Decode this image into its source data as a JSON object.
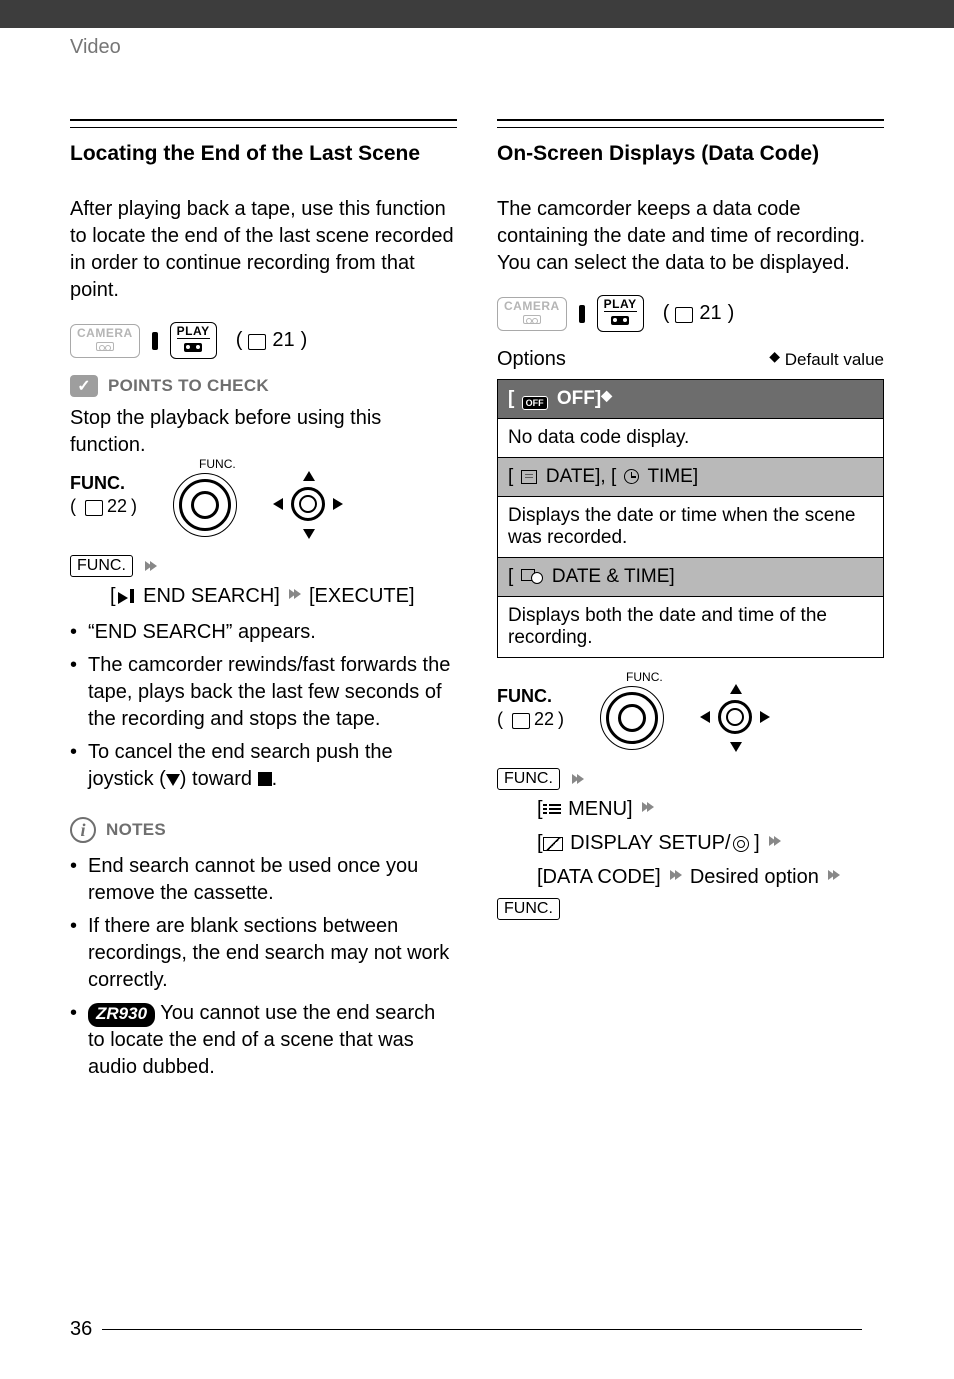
{
  "header": {
    "section": "Video"
  },
  "pageNumber": "36",
  "modeRef": "21",
  "left": {
    "title": "Locating the End of the Last Scene",
    "intro": "After playing back a tape, use this function to locate the end of the last scene recorded in order to continue recording from that point.",
    "modes": {
      "camera": "CAMERA",
      "play": "PLAY"
    },
    "pointsHeading": "POINTS TO CHECK",
    "pointsBody": "Stop the playback before using this function.",
    "func": {
      "label": "FUNC.",
      "ref": "22",
      "dialLabel": "FUNC."
    },
    "step": {
      "funcBox": "FUNC.",
      "endSearch": "END SEARCH]",
      "execute": "[EXECUTE]"
    },
    "bullets": [
      "“END SEARCH” appears.",
      "The camcorder rewinds/fast forwards the tape, plays back the last few seconds of the recording and stops the tape.",
      "To cancel the end search push the joystick (   ) toward    ."
    ],
    "bullet3_pre": "To cancel the end search push the joystick (",
    "bullet3_mid": ") toward ",
    "bullet3_post": ".",
    "notesHeading": "NOTES",
    "notes": {
      "n1": "End search cannot be used once you remove the cassette.",
      "n2": "If there are blank sections between recordings, the end search may not work correctly.",
      "n3_model": "ZR930",
      "n3_text": " You cannot use the end search to locate the end of a scene that was audio dubbed."
    }
  },
  "right": {
    "title": "On-Screen Displays (Data Code)",
    "intro": "The camcorder keeps a data code containing the date and time of recording. You can select the data to be displayed.",
    "modes": {
      "camera": "CAMERA",
      "play": "PLAY"
    },
    "optionsLabel": "Options",
    "defaultLabel": "Default value",
    "table": {
      "offHead": "OFF]",
      "offDesc": "No data code display.",
      "dateTimeHead": {
        "date": "DATE], [",
        "time": "TIME]"
      },
      "dateTimeDesc": "Displays the date or time when the scene was recorded.",
      "bothHead": "DATE & TIME]",
      "bothDesc": "Displays both the date and time of the recording."
    },
    "func": {
      "label": "FUNC.",
      "ref": "22",
      "dialLabel": "FUNC."
    },
    "steps": {
      "funcBox": "FUNC.",
      "menu": "MENU]",
      "displaySetup": "DISPLAY SETUP/",
      "dataCode": "[DATA CODE]",
      "desired": "Desired option",
      "funcBox2": "FUNC."
    }
  }
}
